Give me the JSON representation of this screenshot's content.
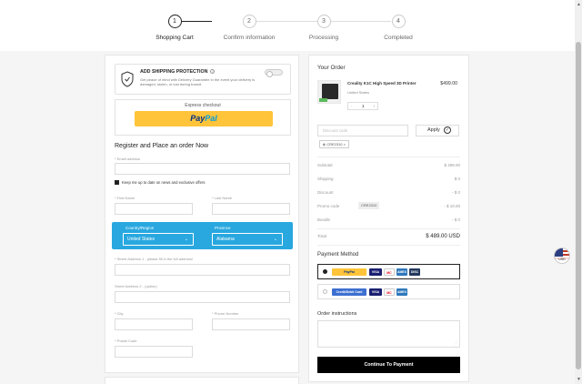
{
  "steps": [
    {
      "num": "1",
      "label": "Shopping Cart",
      "active": true
    },
    {
      "num": "2",
      "label": "Confirm information",
      "active": false
    },
    {
      "num": "3",
      "label": "Processing",
      "active": false
    },
    {
      "num": "4",
      "label": "Completed",
      "active": false
    }
  ],
  "shipping_protection": {
    "title": "ADD SHIPPING PROTECTION",
    "info_icon": "i",
    "description": "Get peace of mind with Delivery Guarantee in the event your delivery is damaged, stolen, or lost during transit.",
    "enabled": false
  },
  "express": {
    "label": "Express checkout",
    "paypal_part1": "Pay",
    "paypal_part2": "Pal"
  },
  "register": {
    "title": "Register and Place an order Now",
    "email_label": "* Email address",
    "newsletter_label": "Keep me up to date on news and exclusive offers",
    "newsletter_checked": true,
    "first_name_label": "* First Name",
    "last_name_label": "* Last Name",
    "country_label": "Country/Region",
    "country_value": "United States",
    "province_label": "Province",
    "province_value": "Alabama",
    "street1_label": "* Street Address 1 - please fill in the full address!",
    "street2_label": "Street Address 2 - (option)",
    "city_label": "* City",
    "phone_label": "* Phone Number",
    "postal_label": "* Postal Code"
  },
  "order": {
    "title": "Your Order",
    "product_name": "Creality K1C High Speed 3D Printer",
    "product_option": "United States",
    "product_price": "$499.00",
    "qty_minus": "-",
    "qty_value": "1",
    "qty_plus": "+",
    "discount_placeholder": "Discount code",
    "apply_label": "Apply",
    "applied_code": "CRE2310",
    "chip_close": "×",
    "summary": [
      {
        "label": "Subtotal",
        "value": "$ 499.00"
      },
      {
        "label": "Shipping",
        "value": "$ 0"
      },
      {
        "label": "Discount",
        "value": "- $ 0"
      },
      {
        "label": "Promo code",
        "value": "- $ 10.00",
        "code": "CRE2310"
      },
      {
        "label": "Bundle",
        "value": "- $ 0"
      }
    ],
    "total_label": "Total",
    "total_value": "$ 489.00 USD",
    "payment_title": "Payment Method",
    "payment_options": [
      {
        "selected": true,
        "logos": [
          "PayPal",
          "VISA",
          "MC",
          "AMEX",
          "DISC"
        ]
      },
      {
        "selected": false,
        "logos": [
          "Credit/Debit Card",
          "VISA",
          "MC",
          "AMEX"
        ]
      }
    ],
    "instructions_title": "Order instructions",
    "cta_label": "Continue To Payment"
  },
  "locale_flag": "USD",
  "colors": {
    "accent_blue": "#29a8e0",
    "paypal_yellow": "#ffc439",
    "cta_black": "#000000"
  }
}
